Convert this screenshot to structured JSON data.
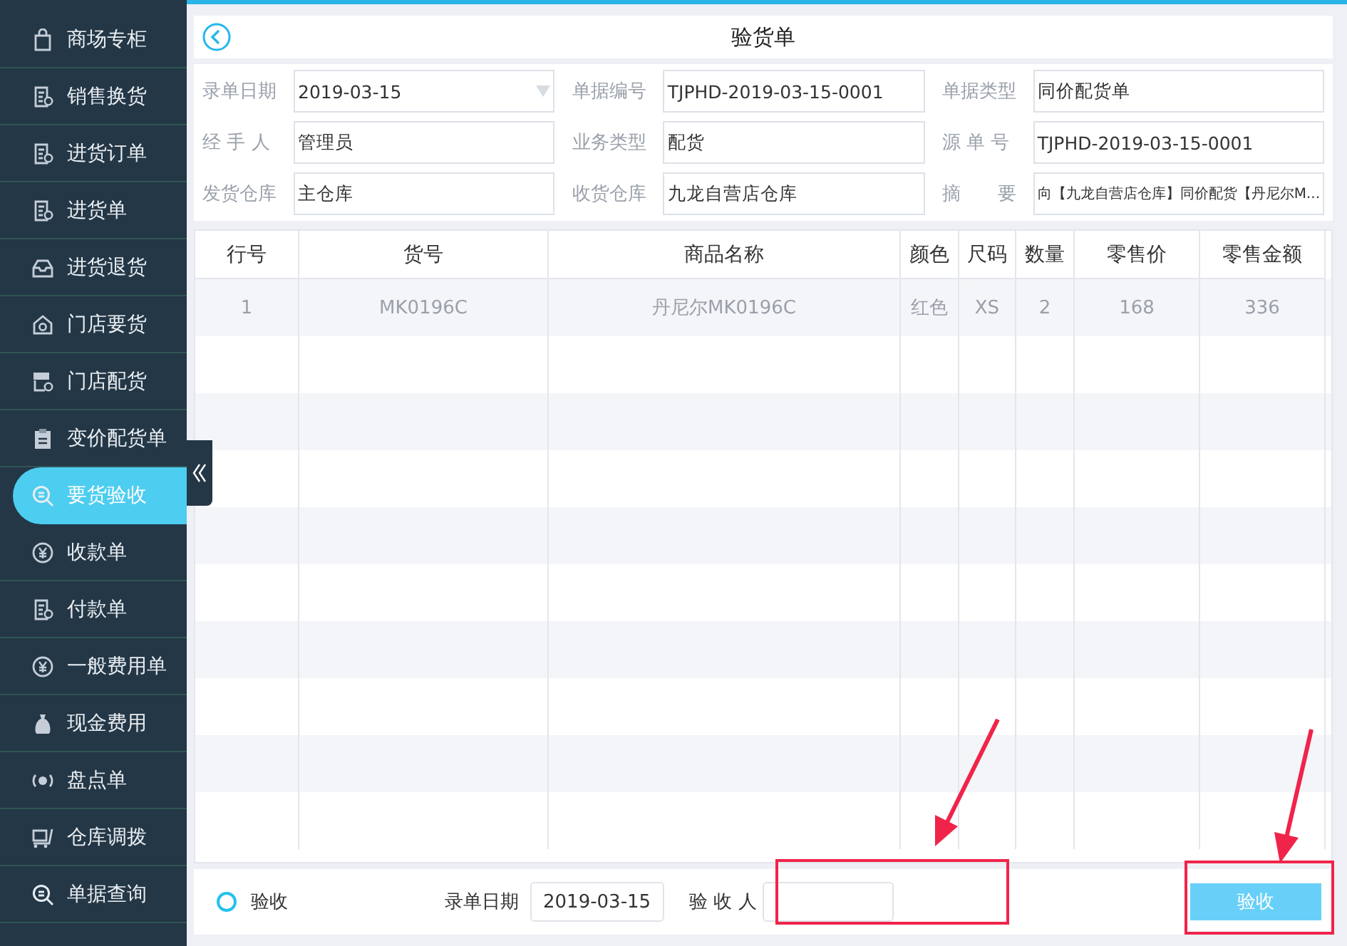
{
  "sidebar": {
    "items": [
      {
        "label": "商场专柜",
        "selected": false
      },
      {
        "label": "销售换货",
        "selected": false
      },
      {
        "label": "进货订单",
        "selected": false
      },
      {
        "label": "进货单",
        "selected": false
      },
      {
        "label": "进货退货",
        "selected": false
      },
      {
        "label": "门店要货",
        "selected": false
      },
      {
        "label": "门店配货",
        "selected": false
      },
      {
        "label": "变价配货单",
        "selected": false
      },
      {
        "label": "要货验收",
        "selected": true
      },
      {
        "label": "收款单",
        "selected": false
      },
      {
        "label": "付款单",
        "selected": false
      },
      {
        "label": "一般费用单",
        "selected": false
      },
      {
        "label": "现金费用",
        "selected": false
      },
      {
        "label": "盘点单",
        "selected": false
      },
      {
        "label": "仓库调拨",
        "selected": false
      },
      {
        "label": "单据查询",
        "selected": false
      }
    ]
  },
  "header": {
    "title": "验货单"
  },
  "form": {
    "fields": [
      {
        "label": "录单日期",
        "value": "2019-03-15",
        "kind": "dropdown"
      },
      {
        "label": "单据编号",
        "value": "TJPHD-2019-03-15-0001",
        "kind": "text"
      },
      {
        "label": "单据类型",
        "value": "同价配货单",
        "kind": "text"
      },
      {
        "label": "经 手 人",
        "value": "管理员",
        "kind": "text"
      },
      {
        "label": "业务类型",
        "value": "配货",
        "kind": "text"
      },
      {
        "label": "源 单 号",
        "value": "TJPHD-2019-03-15-0001",
        "kind": "text"
      },
      {
        "label": "发货仓库",
        "value": "主仓库",
        "kind": "text"
      },
      {
        "label": "收货仓库",
        "value": "九龙自营店仓库",
        "kind": "text"
      },
      {
        "label": "摘　　要",
        "value": "向【九龙自营店仓库】同价配货【丹尼尔M...",
        "kind": "small"
      }
    ]
  },
  "table": {
    "columns": [
      "行号",
      "货号",
      "商品名称",
      "颜色",
      "尺码",
      "数量",
      "零售价",
      "零售金额"
    ],
    "rows": [
      [
        "1",
        "MK0196C",
        "丹尼尔MK0196C",
        "红色",
        "XS",
        "2",
        "168",
        "336"
      ]
    ]
  },
  "footer": {
    "option": {
      "label": "验收",
      "checked": false
    },
    "date_label": "录单日期",
    "date_value": "2019-03-15",
    "person_label": "验 收 人",
    "button": "验收"
  }
}
